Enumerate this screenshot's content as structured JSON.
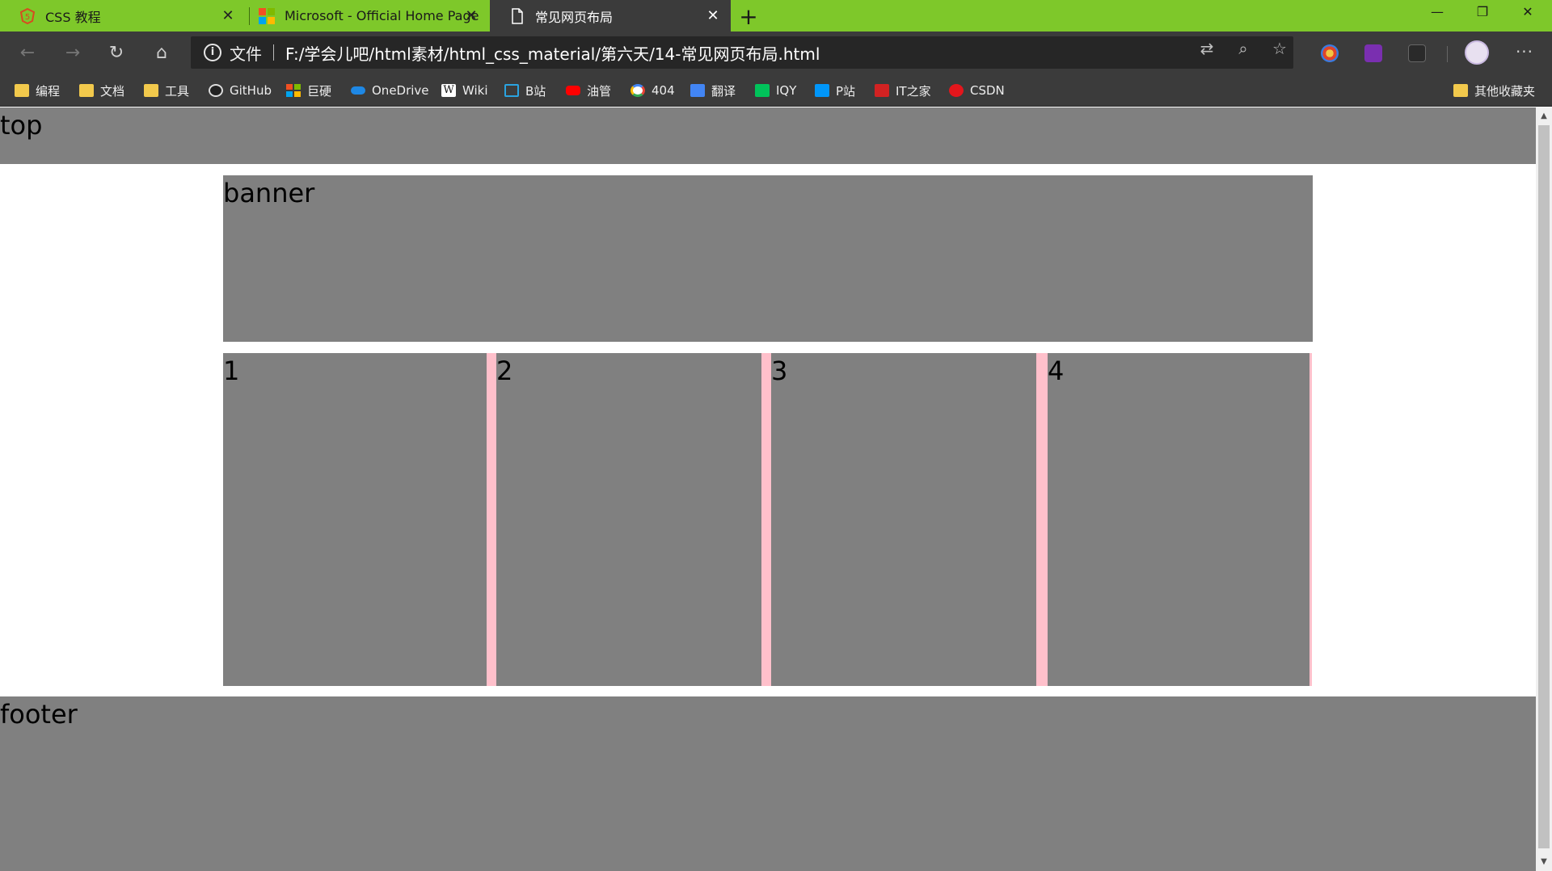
{
  "browser": {
    "tabs": [
      {
        "title": "CSS 教程",
        "favicon": "css-tutorial-icon"
      },
      {
        "title": "Microsoft - Official Home Page",
        "favicon": "microsoft-logo-icon"
      },
      {
        "title": "常见网页布局",
        "favicon": "page-icon"
      }
    ],
    "active_tab": 2,
    "address": {
      "scheme_label": "文件",
      "url": "F:/学会儿吧/html素材/html_css_material/第六天/14-常见网页布局.html"
    },
    "bookmarks": [
      {
        "label": "编程",
        "icon": "folder-icon"
      },
      {
        "label": "文档",
        "icon": "folder-icon"
      },
      {
        "label": "工具",
        "icon": "folder-icon"
      },
      {
        "label": "GitHub",
        "icon": "github-icon"
      },
      {
        "label": "巨硬",
        "icon": "microsoft-logo-icon"
      },
      {
        "label": "OneDrive",
        "icon": "onedrive-icon"
      },
      {
        "label": "Wiki",
        "icon": "wikipedia-icon"
      },
      {
        "label": "B站",
        "icon": "bilibili-icon"
      },
      {
        "label": "油管",
        "icon": "youtube-icon"
      },
      {
        "label": "404",
        "icon": "google-icon"
      },
      {
        "label": "翻译",
        "icon": "translate-icon"
      },
      {
        "label": "IQY",
        "icon": "iqiyi-icon"
      },
      {
        "label": "P站",
        "icon": "p-site-icon"
      },
      {
        "label": "IT之家",
        "icon": "ithome-icon"
      },
      {
        "label": "CSDN",
        "icon": "csdn-icon"
      }
    ],
    "other_bookmarks": "其他收藏夹"
  },
  "page": {
    "top": "top",
    "banner": "banner",
    "columns": [
      "1",
      "2",
      "3",
      "4"
    ],
    "footer": "footer"
  },
  "colors": {
    "titlebar": "#7ec82a",
    "chrome": "#3b3b3b",
    "box": "#808080",
    "separator": "#ffc0cb"
  }
}
